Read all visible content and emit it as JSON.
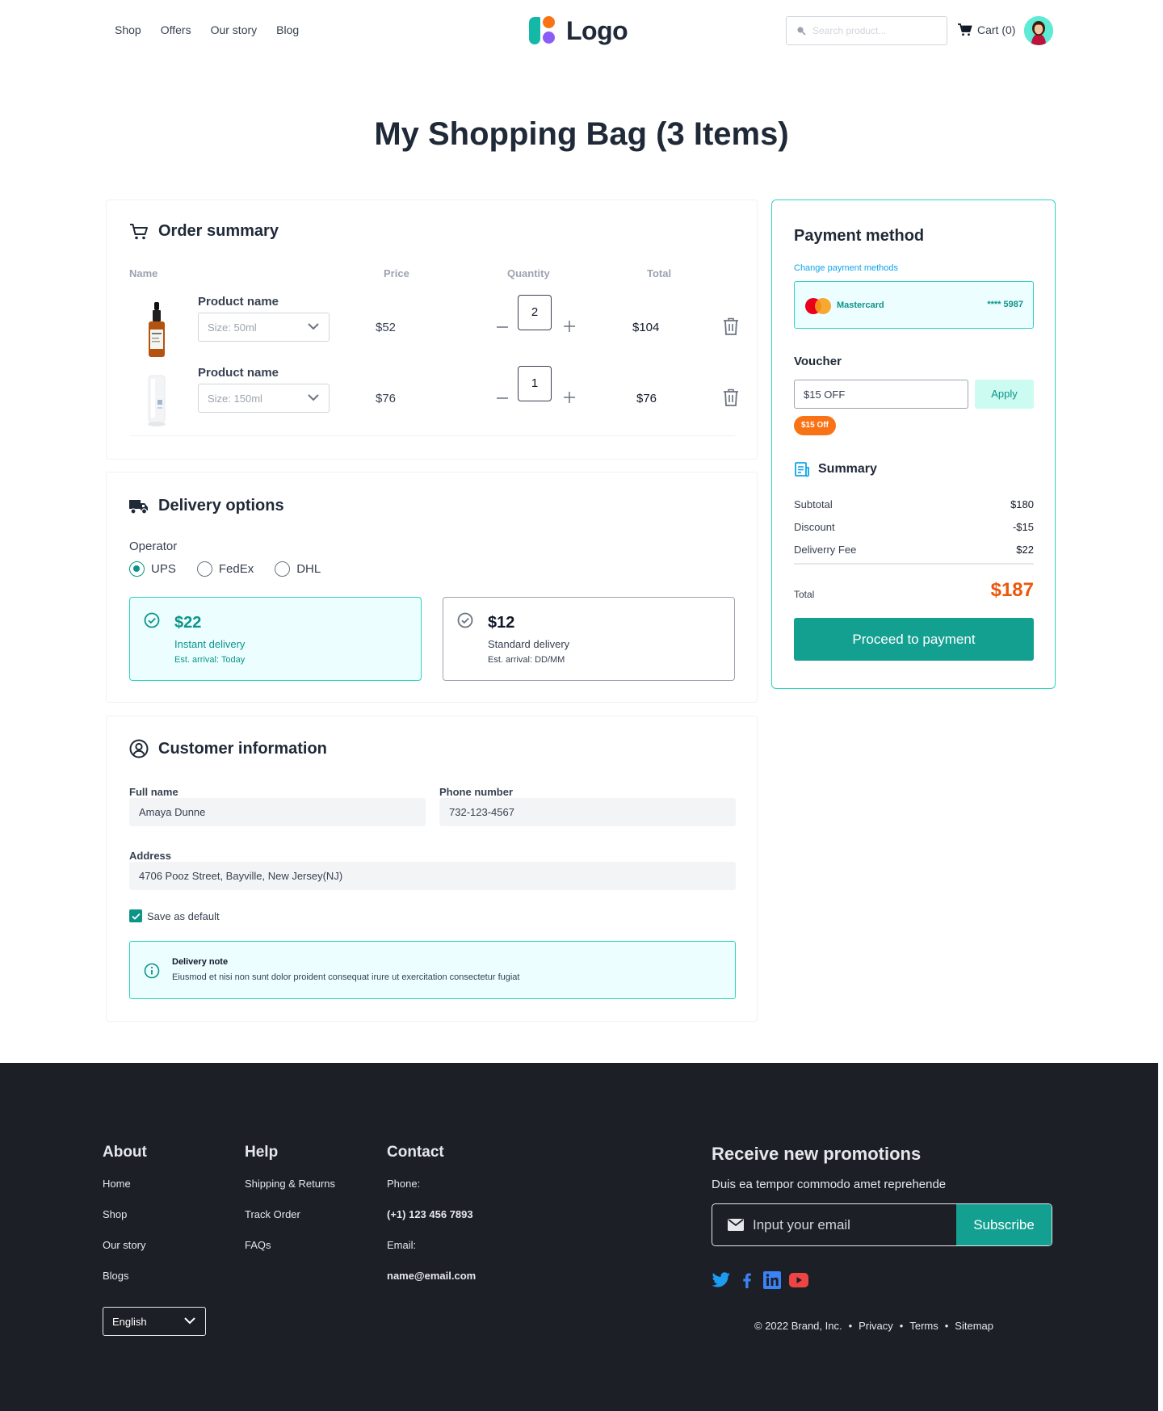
{
  "nav": {
    "links": [
      "Shop",
      "Offers",
      "Our story",
      "Blog"
    ],
    "logo_text": "Logo",
    "search_placeholder": "Search product...",
    "cart_label": "Cart (0)"
  },
  "page_title": "My Shopping Bag (3 Items)",
  "order_summary": {
    "title": "Order summary",
    "columns": [
      "Name",
      "Price",
      "Quantity",
      "Total"
    ],
    "items": [
      {
        "name": "Product name",
        "size": "Size: 50ml",
        "price": "$52",
        "quantity": "2",
        "total": "$104"
      },
      {
        "name": "Product name",
        "size": "Size: 150ml",
        "price": "$76",
        "quantity": "1",
        "total": "$76"
      }
    ]
  },
  "delivery": {
    "title": "Delivery options",
    "operator_label": "Operator",
    "operators": [
      "UPS",
      "FedEx",
      "DHL"
    ],
    "selected_operator": "UPS",
    "options": [
      {
        "amount": "$22",
        "type": "Instant delivery",
        "eta": "Est. arrival: Today",
        "selected": true
      },
      {
        "amount": "$12",
        "type": "Standard delivery",
        "eta": "Est. arrival: DD/MM",
        "selected": false
      }
    ]
  },
  "customer": {
    "title": "Customer information",
    "full_name_label": "Full name",
    "full_name": "Amaya Dunne",
    "phone_label": "Phone number",
    "phone": "732-123-4567",
    "address_label": "Address",
    "address": "4706 Pooz Street, Bayville, New Jersey(NJ)",
    "save_default": "Save as default",
    "note_title": "Delivery note",
    "note_text": "Eiusmod et nisi non sunt dolor proident consequat irure ut exercitation consectetur fugiat"
  },
  "payment": {
    "title": "Payment method",
    "change_link": "Change payment methods",
    "card_brand": "Mastercard",
    "card_number": "**** 5987",
    "voucher_label": "Voucher",
    "voucher_value": "$15 OFF",
    "apply_label": "Apply",
    "voucher_badge": "$15 Off",
    "summary_title": "Summary",
    "rows": [
      {
        "label": "Subtotal",
        "value": "$180"
      },
      {
        "label": "Discount",
        "value": "-$15"
      },
      {
        "label": "Deliverry Fee",
        "value": "$22"
      }
    ],
    "total_label": "Total",
    "total_value": "$187",
    "proceed_label": "Proceed to payment"
  },
  "footer": {
    "about": {
      "title": "About",
      "items": [
        "Home",
        "Shop",
        "Our story",
        "Blogs"
      ]
    },
    "help": {
      "title": "Help",
      "items": [
        "Shipping & Returns",
        "Track Order",
        "FAQs"
      ]
    },
    "contact": {
      "title": "Contact",
      "phone_label": "Phone:",
      "phone": "(+1) 123 456 7893",
      "email_label": "Email:",
      "email": "name@email.com"
    },
    "language": "English",
    "promo_title": "Receive new promotions",
    "promo_sub": "Duis ea tempor commodo amet reprehende",
    "email_placeholder": "Input your email",
    "subscribe_label": "Subscribe",
    "socials": [
      "twitter-icon",
      "facebook-icon",
      "linkedin-icon",
      "youtube-icon"
    ],
    "copyright": "© 2022 Brand, Inc.",
    "legal_links": [
      "Privacy",
      "Terms",
      "Sitemap"
    ]
  },
  "colors": {
    "accent": "#14a091",
    "accent_light": "#ecfeff",
    "highlight": "#ea580c",
    "footer_bg": "#1c1f26"
  }
}
